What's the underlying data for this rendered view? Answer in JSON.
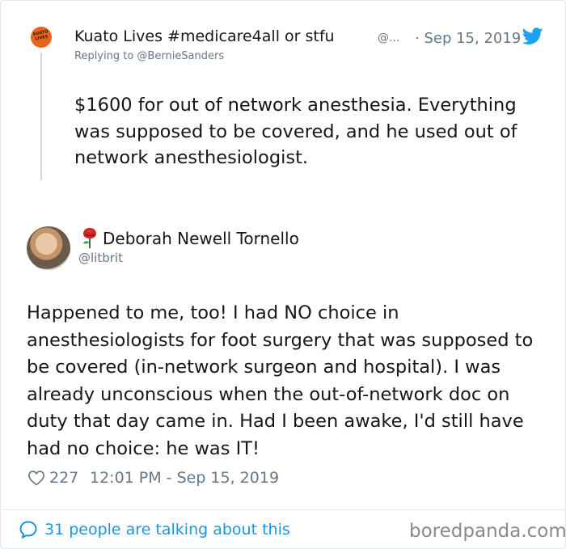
{
  "parent_tweet": {
    "avatar_text": "KUATO LIVES",
    "display_name": "Kuato Lives #medicare4all or stfu",
    "handle": "@...",
    "date": "· Sep 15, 2019",
    "replying_to": "Replying to @BernieSanders",
    "text": "$1600 for out of network anesthesia. Everything was supposed to be covered, and he used out of network anesthesiologist."
  },
  "reply_tweet": {
    "display_name": "Deborah Newell Tornello",
    "handle": "@litbrit",
    "text": "Happened to me, too! I had NO choice in anesthesiologists for foot surgery that was supposed to be covered (in-network surgeon and hospital). I was already unconscious when the out-of-network doc on duty that day came in. Had I been awake, I'd still have had no choice: he was IT!",
    "likes": "227",
    "timestamp": "12:01 PM - Sep 15, 2019",
    "name_emoji_icon": "rose-icon"
  },
  "footer": {
    "talking": "31 people are talking about this",
    "watermark": "boredpanda.com"
  },
  "icons": {
    "brand": "twitter-bird-icon",
    "like": "heart-icon",
    "conversation": "speech-bubble-icon"
  },
  "colors": {
    "twitter_blue": "#1da1f2",
    "link_blue": "#1b95e0",
    "secondary_text": "#657786",
    "primary_text": "#14171a",
    "border": "#e1e8ed"
  }
}
